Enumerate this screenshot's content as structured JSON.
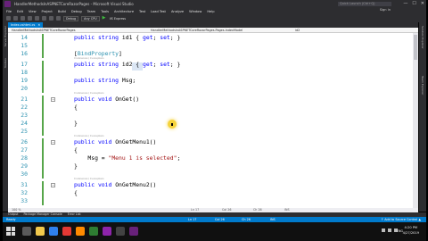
{
  "window": {
    "title": "HandlerMethodsInASPNETCoreRazorPages - Microsoft Visual Studio",
    "quick_launch": "Quick Launch (Ctrl+Q)",
    "controls": [
      "—",
      "☐",
      "✕"
    ]
  },
  "menu": [
    "File",
    "Edit",
    "View",
    "Project",
    "Build",
    "Debug",
    "Team",
    "Tools",
    "Architecture",
    "Test",
    "Load Test",
    "Analyze",
    "Window",
    "Help"
  ],
  "menu_signin": "Sign in",
  "toolbar": {
    "configuration": "Debug",
    "platform": "Any CPU",
    "run_target": "IIS Express"
  },
  "left_strip": [
    "Server Explorer",
    "Toolbox"
  ],
  "right_strip": [
    "Solution Explorer",
    "Team Explorer"
  ],
  "tabs": [
    {
      "label": "Index.cshtml.cs",
      "active": true
    }
  ],
  "navbar": {
    "project": "HandlerMethodsInASPNETCoreRazorPages",
    "class": "HandlerMethodsInASPNETCoreRazorPages.Pages.IndexModel",
    "member": "id2"
  },
  "code_lines": [
    {
      "n": "14",
      "tokens": [
        {
          "k": "kw",
          "t": "public "
        },
        {
          "k": "kw",
          "t": "string "
        },
        {
          "k": "",
          "t": "id1 { "
        },
        {
          "k": "kw",
          "t": "get"
        },
        {
          "k": "",
          "t": "; "
        },
        {
          "k": "kw",
          "t": "set"
        },
        {
          "k": "",
          "t": "; }"
        }
      ]
    },
    {
      "n": "15",
      "tokens": []
    },
    {
      "n": "16",
      "tokens": [
        {
          "k": "",
          "t": "["
        },
        {
          "k": "attr",
          "t": "BindProperty"
        },
        {
          "k": "",
          "t": "]"
        }
      ]
    },
    {
      "n": "17",
      "tokens": [
        {
          "k": "kw",
          "t": "public "
        },
        {
          "k": "kw",
          "t": "string "
        },
        {
          "k": "",
          "t": "id2 { "
        },
        {
          "k": "kw",
          "t": "get"
        },
        {
          "k": "",
          "t": "; "
        },
        {
          "k": "kw",
          "t": "set"
        },
        {
          "k": "",
          "t": "; }"
        }
      ],
      "refs": "0 references | 0 exceptions"
    },
    {
      "n": "18",
      "tokens": []
    },
    {
      "n": "19",
      "tokens": [
        {
          "k": "kw",
          "t": "public "
        },
        {
          "k": "kw",
          "t": "string "
        },
        {
          "k": "",
          "t": "Msg;"
        }
      ]
    },
    {
      "n": "20",
      "tokens": []
    },
    {
      "n": "21",
      "tokens": [
        {
          "k": "kw",
          "t": "public "
        },
        {
          "k": "kw",
          "t": "void "
        },
        {
          "k": "",
          "t": "OnGet()"
        }
      ],
      "refs": "0 references | 0 exceptions"
    },
    {
      "n": "22",
      "tokens": [
        {
          "k": "",
          "t": "{"
        }
      ]
    },
    {
      "n": "23",
      "tokens": []
    },
    {
      "n": "24",
      "tokens": [
        {
          "k": "",
          "t": "}"
        }
      ]
    },
    {
      "n": "25",
      "tokens": []
    },
    {
      "n": "26",
      "tokens": [
        {
          "k": "kw",
          "t": "public "
        },
        {
          "k": "kw",
          "t": "void "
        },
        {
          "k": "",
          "t": "OnGetMenu1()"
        }
      ],
      "refs": "0 references | 0 exceptions"
    },
    {
      "n": "27",
      "tokens": [
        {
          "k": "",
          "t": "{"
        }
      ]
    },
    {
      "n": "28",
      "tokens": [
        {
          "k": "",
          "t": "    Msg = "
        },
        {
          "k": "str",
          "t": "\"Menu 1 is selected\""
        },
        {
          "k": "",
          "t": ";"
        }
      ]
    },
    {
      "n": "29",
      "tokens": [
        {
          "k": "",
          "t": "}"
        }
      ]
    },
    {
      "n": "30",
      "tokens": []
    },
    {
      "n": "31",
      "tokens": [
        {
          "k": "kw",
          "t": "public "
        },
        {
          "k": "kw",
          "t": "void "
        },
        {
          "k": "",
          "t": "OnGetMenu2()"
        }
      ],
      "refs": "0 references | 0 exceptions"
    },
    {
      "n": "32",
      "tokens": [
        {
          "k": "",
          "t": "{"
        }
      ]
    },
    {
      "n": "33",
      "tokens": []
    }
  ],
  "editor_status": {
    "zoom": "100 %",
    "ln": "Ln 17",
    "col": "Col 26",
    "ch": "Ch 26",
    "ins": "INS"
  },
  "tool_tabs": [
    "Output",
    "Package Manager Console",
    "Error List"
  ],
  "status": {
    "left": "Ready",
    "ln": "Ln 17",
    "col": "Col 26",
    "ch": "Ch 26",
    "ins": "INS",
    "source_control": "↑ Add to Source Control ▲"
  },
  "taskbar": {
    "apps": [
      {
        "name": "task-view",
        "color": "#5a5a5a"
      },
      {
        "name": "file-explorer",
        "color": "#f2c94c"
      },
      {
        "name": "edge",
        "color": "#2f80ed"
      },
      {
        "name": "chrome",
        "color": "#e53935"
      },
      {
        "name": "firefox",
        "color": "#ff8a00"
      },
      {
        "name": "sticky-notes",
        "color": "#2e7d32"
      },
      {
        "name": "media-player",
        "color": "#8e24aa"
      },
      {
        "name": "calculator",
        "color": "#424242"
      },
      {
        "name": "visual-studio",
        "color": "#68217a"
      }
    ],
    "lang": "ENG",
    "time": "4:20 PM",
    "date": "4/27/2019"
  },
  "colors": {
    "accent": "#007acc",
    "keyword": "#0000ff",
    "string": "#a31515",
    "type": "#2b91af",
    "vs_purple": "#68217a"
  }
}
